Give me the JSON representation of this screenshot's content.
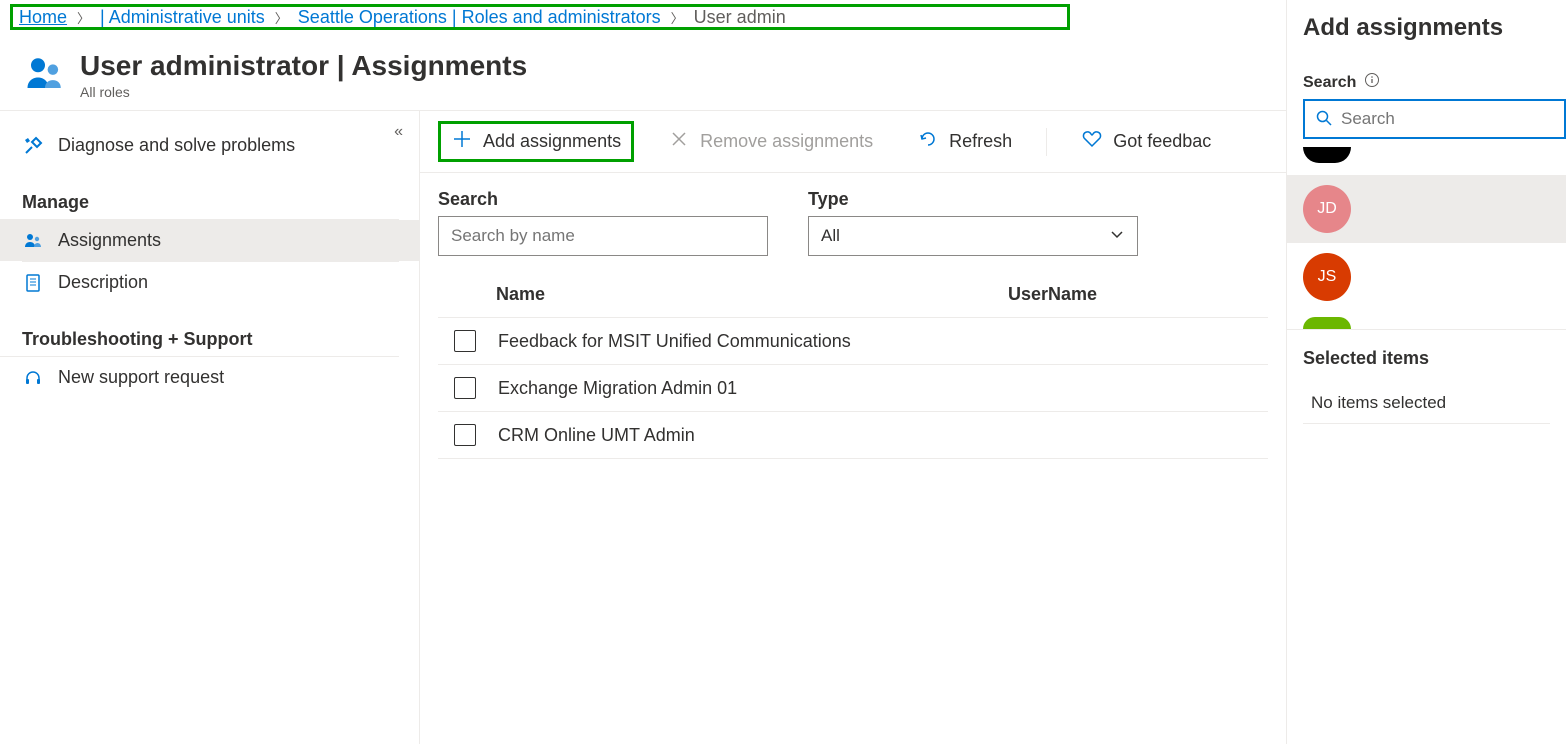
{
  "breadcrumb": {
    "home": "Home",
    "admin_units": "| Administrative units",
    "ops": "Seattle Operations | Roles and administrators",
    "current": "User admin"
  },
  "header": {
    "title": "User administrator | Assignments",
    "subtitle": "All roles"
  },
  "sidebar": {
    "diagnose": "Diagnose and solve problems",
    "manage": "Manage",
    "assignments": "Assignments",
    "description": "Description",
    "troubleshoot": "Troubleshooting + Support",
    "support": "New support request"
  },
  "toolbar": {
    "add": "Add assignments",
    "remove": "Remove assignments",
    "refresh": "Refresh",
    "feedback": "Got feedbac"
  },
  "filters": {
    "search_label": "Search",
    "search_placeholder": "Search by name",
    "type_label": "Type",
    "type_value": "All"
  },
  "table": {
    "col_name": "Name",
    "col_user": "UserName",
    "rows": [
      {
        "name": "Feedback for MSIT Unified Communications"
      },
      {
        "name": "Exchange Migration Admin 01"
      },
      {
        "name": "CRM Online UMT Admin"
      }
    ]
  },
  "panel": {
    "title": "Add assignments",
    "search_label": "Search",
    "search_placeholder": "Search",
    "users": [
      {
        "initials": "",
        "color": "#000000",
        "cut": "top"
      },
      {
        "initials": "JD",
        "color": "#e6868a",
        "selected": true
      },
      {
        "initials": "JS",
        "color": "#d83b01",
        "selected": false
      },
      {
        "initials": "",
        "color": "#6bb700",
        "cut": "bottom"
      }
    ],
    "selected_heading": "Selected items",
    "selected_empty": "No items selected"
  }
}
